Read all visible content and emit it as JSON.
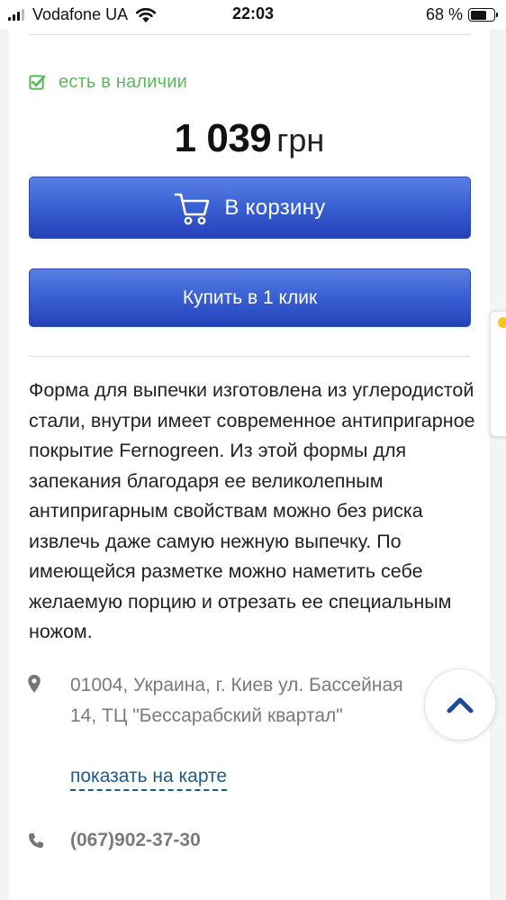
{
  "status_bar": {
    "carrier": "Vodafone UA",
    "time": "22:03",
    "battery_percent": "68 %",
    "battery_level": 0.68,
    "signal_bars": 3
  },
  "product": {
    "availability": "есть в наличии",
    "price_value": "1 039",
    "price_currency": "грн",
    "add_to_cart_label": "В корзину",
    "one_click_label": "Купить в 1 клик",
    "description": "Форма для выпечки изготовлена из углеродистой стали, внутри имеет современное антипригарное покрытие Fernogreen. Из этой формы для запекания благодаря ее великолепным антипригарным свойствам можно без риска извлечь даже самую нежную выпечку. По имеющейся разметке можно наметить себе желаемую порцию и отрезать ее специальным ножом."
  },
  "store": {
    "address": "01004, Украина, г. Киев ул. Бассейная 14, ТЦ \"Бессарабский квартал\"",
    "map_link": "показать на карте",
    "phone": "(067)902-37-30"
  },
  "colors": {
    "availability_green": "#5cb85c",
    "button_blue": "#3b62d4",
    "link_blue": "#1c5b8c",
    "muted_gray": "#7a7a7a",
    "scroll_arrow": "#1e4a9c"
  },
  "icons": {
    "availability": "checkbox-check-icon",
    "cart": "shopping-cart-icon",
    "address": "map-pin-icon",
    "phone": "phone-icon",
    "scroll_top": "chevron-up-icon"
  }
}
